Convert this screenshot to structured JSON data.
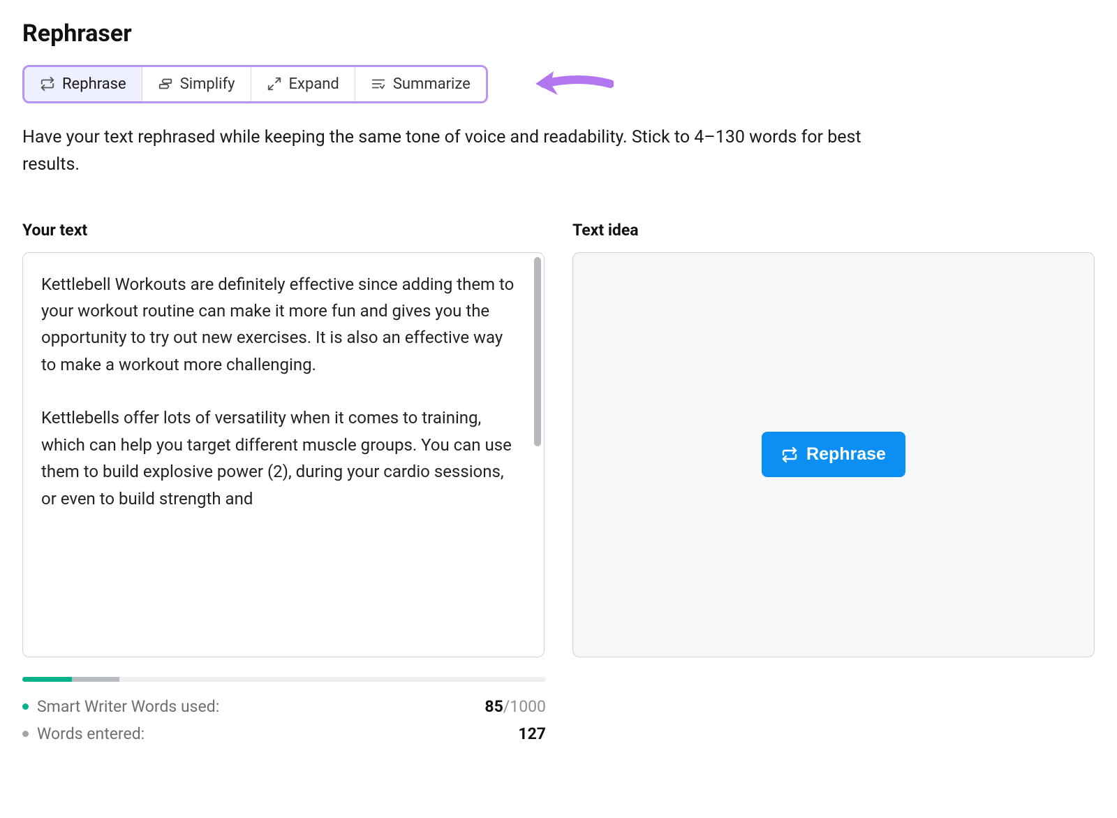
{
  "title": "Rephraser",
  "tabs": [
    {
      "id": "rephrase",
      "label": "Rephrase",
      "active": true
    },
    {
      "id": "simplify",
      "label": "Simplify",
      "active": false
    },
    {
      "id": "expand",
      "label": "Expand",
      "active": false
    },
    {
      "id": "summarize",
      "label": "Summarize",
      "active": false
    }
  ],
  "description": "Have your text rephrased while keeping the same tone of voice and readability. Stick to 4–130 words for best results.",
  "leftPane": {
    "label": "Your text",
    "value": "Kettlebell Workouts are definitely effective since adding them to your workout routine can make it more fun and gives you the opportunity to try out new exercises. It is also an effective way to make a workout more challenging.\n\nKettlebells offer lots of versatility when it comes to training, which can help you target different muscle groups. You can use them to build explosive power (2), during your cardio sessions, or even to build strength and"
  },
  "rightPane": {
    "label": "Text idea",
    "buttonLabel": "Rephrase"
  },
  "stats": {
    "smartWriter": {
      "label": "Smart Writer Words used:",
      "used": "85",
      "total": "1000"
    },
    "wordsEntered": {
      "label": "Words entered:",
      "value": "127"
    }
  }
}
